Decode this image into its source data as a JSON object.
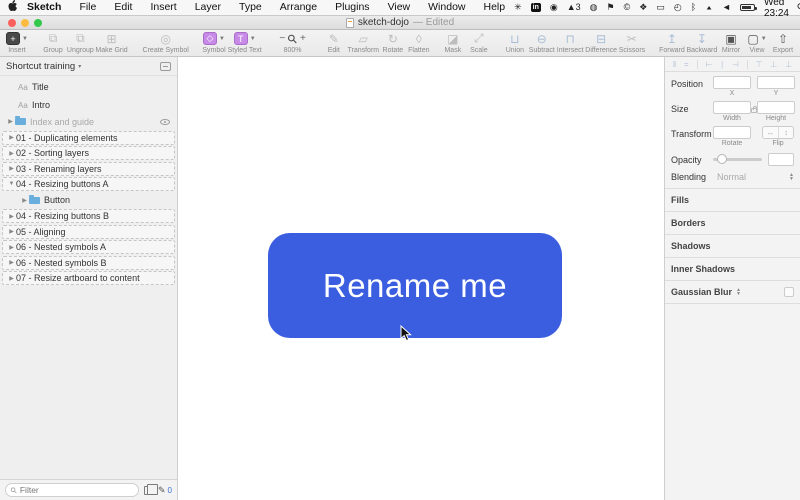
{
  "menubar": {
    "menus": [
      "Sketch",
      "File",
      "Edit",
      "Insert",
      "Layer",
      "Type",
      "Arrange",
      "Plugins",
      "View",
      "Window",
      "Help"
    ],
    "status_icons": [
      {
        "name": "flower-icon",
        "glyph": "✳"
      },
      {
        "name": "linkedin-icon",
        "glyph": "in",
        "badge": true
      },
      {
        "name": "record-icon",
        "glyph": "◉"
      },
      {
        "name": "app-count-icon",
        "glyph": "▲3"
      },
      {
        "name": "globe-icon",
        "glyph": "◍"
      },
      {
        "name": "flag-icon",
        "glyph": "⚑"
      },
      {
        "name": "copyright-icon",
        "glyph": "©"
      },
      {
        "name": "dropbox-icon",
        "glyph": "❖"
      },
      {
        "name": "display-icon",
        "glyph": "▭"
      },
      {
        "name": "time-machine-icon",
        "glyph": "◴"
      },
      {
        "name": "bluetooth-icon",
        "glyph": "ᛒ"
      },
      {
        "name": "wifi-icon",
        "glyph": "▲",
        "wifi": true
      },
      {
        "name": "volume-icon",
        "glyph": "◄"
      },
      {
        "name": "battery-icon",
        "battery": true
      }
    ],
    "clock": "Wed 23:24",
    "right_icons": [
      {
        "name": "spotlight-icon",
        "glyph": "⚲"
      },
      {
        "name": "siri-like-icon",
        "glyph": "◍"
      },
      {
        "name": "notification-center-icon",
        "glyph": "≡"
      }
    ]
  },
  "window": {
    "title": "sketch-dojo",
    "status": "— Edited"
  },
  "toolbar": {
    "zoom_level": "800%",
    "zoom_minus": "−",
    "zoom_plus": "+",
    "items": [
      {
        "name": "insert",
        "label": "Insert",
        "glyph": "+",
        "style": "chip-dark",
        "caret": true,
        "enabled": true
      },
      {
        "name": "group",
        "label": "Group",
        "glyph": "⧉",
        "enabled": false,
        "gap": 10
      },
      {
        "name": "ungroup",
        "label": "Ungroup",
        "glyph": "⧉",
        "enabled": false
      },
      {
        "name": "make-grid",
        "label": "Make Grid",
        "glyph": "⊞",
        "enabled": false
      },
      {
        "name": "create-symbol",
        "label": "Create Symbol",
        "glyph": "◎",
        "enabled": false,
        "gap": 14
      },
      {
        "name": "symbol",
        "label": "Symbol",
        "glyph": "◇",
        "style": "chip-purple",
        "caret": true,
        "enabled": true,
        "gap": 12
      },
      {
        "name": "styled-text",
        "label": "Styled Text",
        "glyph": "T",
        "style": "chip-purple",
        "caret": true,
        "enabled": true
      },
      {
        "name": "zoom",
        "type": "zoom",
        "gap": 16
      },
      {
        "name": "edit",
        "label": "Edit",
        "glyph": "✎",
        "enabled": false,
        "gap": 14
      },
      {
        "name": "transform",
        "label": "Transform",
        "glyph": "▱",
        "enabled": false
      },
      {
        "name": "rotate",
        "label": "Rotate",
        "glyph": "↻",
        "enabled": false
      },
      {
        "name": "flatten",
        "label": "Flatten",
        "glyph": "◊",
        "enabled": false
      },
      {
        "name": "mask",
        "label": "Mask",
        "glyph": "◪",
        "enabled": false,
        "gap": 8
      },
      {
        "name": "scale",
        "label": "Scale",
        "glyph": "⤢",
        "enabled": false
      },
      {
        "name": "union",
        "label": "Union",
        "glyph": "⊔",
        "enabled": false,
        "blue": true,
        "gap": 10
      },
      {
        "name": "subtract",
        "label": "Subtract",
        "glyph": "⊖",
        "enabled": false,
        "blue": true
      },
      {
        "name": "intersect",
        "label": "Intersect",
        "glyph": "⊓",
        "enabled": false,
        "blue": true
      },
      {
        "name": "difference",
        "label": "Difference",
        "glyph": "⊟",
        "enabled": false,
        "blue": true
      },
      {
        "name": "scissors",
        "label": "Scissors",
        "glyph": "✂",
        "enabled": false
      },
      {
        "name": "forward",
        "label": "Forward",
        "glyph": "↥",
        "enabled": false,
        "blue": true,
        "gap": 12
      },
      {
        "name": "backward",
        "label": "Backward",
        "glyph": "↧",
        "enabled": false,
        "blue": true
      },
      {
        "name": "mirror",
        "label": "Mirror",
        "glyph": "▣",
        "enabled": true,
        "push": true
      },
      {
        "name": "view",
        "label": "View",
        "glyph": "▢",
        "caret": true,
        "enabled": true
      },
      {
        "name": "export",
        "label": "Export",
        "glyph": "⇧",
        "enabled": true
      }
    ]
  },
  "sidebar": {
    "header": {
      "title": "Shortcut training",
      "caret": "▾"
    },
    "layers": [
      {
        "type": "text",
        "label": "Title",
        "icon": "Aa"
      },
      {
        "type": "text",
        "label": "Intro",
        "icon": "Aa"
      },
      {
        "type": "group",
        "label": "Index and guide",
        "dim": true,
        "eye": true,
        "caret": "▶"
      },
      {
        "type": "artboard",
        "label": "01 - Duplicating elements",
        "caret": "▶"
      },
      {
        "type": "artboard",
        "label": "02 - Sorting layers",
        "caret": "▶"
      },
      {
        "type": "artboard",
        "label": "03 - Renaming layers",
        "caret": "▶"
      },
      {
        "type": "artboard",
        "label": "04 - Resizing buttons A",
        "caret": "▼"
      },
      {
        "type": "group",
        "label": "Button",
        "indent": 1,
        "caret": "▶"
      },
      {
        "type": "artboard",
        "label": "04 - Resizing buttons B",
        "caret": "▶"
      },
      {
        "type": "artboard",
        "label": "05 - Aligning",
        "caret": "▶"
      },
      {
        "type": "artboard",
        "label": "06 - Nested symbols A",
        "caret": "▶"
      },
      {
        "type": "artboard",
        "label": "06 - Nested symbols B",
        "caret": "▶"
      },
      {
        "type": "artboard",
        "label": "07 - Resize artboard to content",
        "caret": "▶"
      }
    ],
    "filter": {
      "placeholder": "Filter"
    },
    "pencil_count": "0"
  },
  "canvas": {
    "button": {
      "label": "Rename me",
      "color": "#3B5EE1"
    }
  },
  "inspector": {
    "align_icons": [
      {
        "name": "distribute-horizontal-icon",
        "glyph": "‖"
      },
      {
        "name": "distribute-vertical-icon",
        "glyph": "="
      },
      {
        "name": "align-left-icon",
        "glyph": "⊢",
        "sep": true
      },
      {
        "name": "align-center-h-icon",
        "glyph": "∣"
      },
      {
        "name": "align-right-icon",
        "glyph": "⊣"
      },
      {
        "name": "align-top-icon",
        "glyph": "⊤",
        "sep": true
      },
      {
        "name": "align-middle-icon",
        "glyph": "⊥"
      },
      {
        "name": "align-bottom-icon",
        "glyph": "⊥"
      }
    ],
    "position": {
      "label": "Position",
      "x_label": "X",
      "y_label": "Y",
      "x": "",
      "y": ""
    },
    "size": {
      "label": "Size",
      "width_label": "Width",
      "height_label": "Height",
      "width": "",
      "height": ""
    },
    "transform": {
      "label": "Transform",
      "rotate_label": "Rotate",
      "flip_label": "Flip",
      "rotate": ""
    },
    "opacity": {
      "label": "Opacity",
      "value": ""
    },
    "blending": {
      "label": "Blending",
      "value": "Normal"
    },
    "sections": [
      {
        "label": "Fills"
      },
      {
        "label": "Borders"
      },
      {
        "label": "Shadows"
      },
      {
        "label": "Inner Shadows"
      },
      {
        "label": "Gaussian Blur",
        "stepper": true,
        "checkbox": true
      }
    ]
  }
}
